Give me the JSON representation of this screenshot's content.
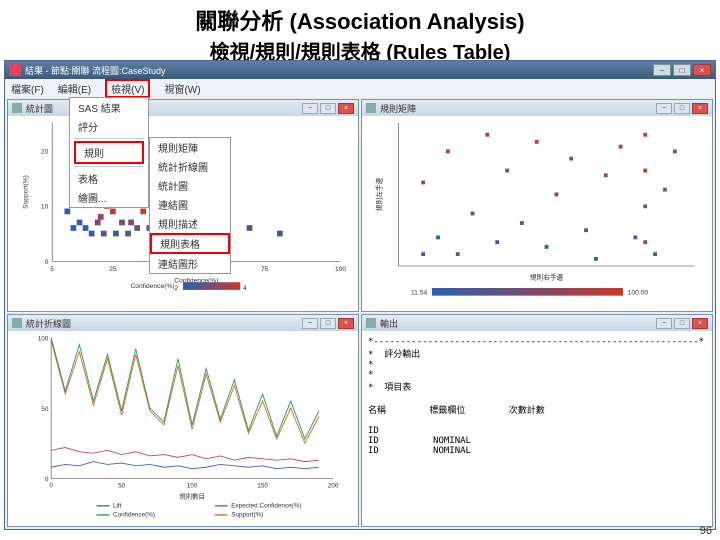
{
  "slide": {
    "title1": "關聯分析 (Association Analysis)",
    "title2": "檢視/規則/規則表格 (Rules Table)",
    "page_num": "96"
  },
  "app": {
    "titlebar": "結果 - 節點:關聯  流程圖:CaseStudy",
    "menu": {
      "file": "檔案(F)",
      "edit": "編輯(E)",
      "view": "檢視(V)",
      "window": "視窗(W)"
    }
  },
  "dropdown_main": {
    "items": [
      "SAS 結果",
      "評分"
    ],
    "boxed": "規則",
    "tail": [
      "表格",
      "繪圖..."
    ]
  },
  "dropdown_sub": {
    "items": [
      "規則矩陣",
      "統計折線圖",
      "統計圖",
      "連結圖",
      "規則描述"
    ],
    "boxed": "規則表格",
    "last": "連結圖形"
  },
  "panels": {
    "p1": {
      "title": "統計圖",
      "ylabel": "Support(%)",
      "xlabel": "Confidence(%)",
      "legend": "Confidence(%)",
      "legend_lo": "2",
      "legend_hi": "4"
    },
    "p2": {
      "title": "規則矩陣",
      "xlabel": "規則右手邊",
      "ylabel": "規則左手邊",
      "legend_lo": "11.54",
      "legend_hi": "100.00"
    },
    "p3": {
      "title": "統計折線圖",
      "xlabel": "規則數目",
      "legend1": "Lift",
      "legend2": "Expected Confidence(%)",
      "legend3": "Confidence(%)",
      "legend4": "Support(%)"
    },
    "p4": {
      "title": "輸出",
      "body_lines": [
        "*------------------------------------------------------------*",
        "*  評分輸出",
        "*",
        "*",
        "*  項目表",
        "",
        "名稱        標籤欄位        次數計數",
        "",
        "ID",
        "ID          NOMINAL",
        "ID          NOMINAL"
      ]
    }
  },
  "chart_data": [
    {
      "type": "scatter",
      "panel": "p1",
      "title": "統計圖",
      "xlabel": "Confidence(%)",
      "ylabel": "Support(%)",
      "xlim": [
        5,
        100
      ],
      "ylim": [
        0,
        25
      ],
      "color_scale": {
        "low": "#2b5fb3",
        "high": "#c63a2b",
        "variable": "index"
      },
      "series": [
        {
          "name": "rules",
          "points": [
            [
              10,
              9,
              0
            ],
            [
              12,
              6,
              0
            ],
            [
              14,
              7,
              1
            ],
            [
              16,
              6,
              0
            ],
            [
              18,
              5,
              1
            ],
            [
              20,
              7,
              5
            ],
            [
              21,
              8,
              6
            ],
            [
              22,
              5,
              2
            ],
            [
              23,
              10,
              9
            ],
            [
              25,
              9,
              8
            ],
            [
              26,
              5,
              1
            ],
            [
              28,
              7,
              4
            ],
            [
              30,
              5,
              2
            ],
            [
              31,
              7,
              5
            ],
            [
              33,
              6,
              3
            ],
            [
              35,
              9,
              9
            ],
            [
              37,
              6,
              2
            ],
            [
              38,
              5,
              1
            ],
            [
              40,
              7,
              5
            ],
            [
              42,
              5,
              0
            ],
            [
              45,
              6,
              3
            ],
            [
              48,
              9,
              8
            ],
            [
              14,
              15,
              4
            ],
            [
              18,
              20,
              9
            ],
            [
              22,
              12,
              6
            ],
            [
              50,
              5,
              1
            ],
            [
              55,
              6,
              4
            ],
            [
              60,
              5,
              0
            ],
            [
              70,
              6,
              3
            ],
            [
              80,
              5,
              1
            ]
          ]
        }
      ]
    },
    {
      "type": "scatter",
      "panel": "p2",
      "title": "規則矩陣",
      "xlabel": "規則右手邊",
      "ylabel": "規則左手邊",
      "xlim": [
        0,
        60
      ],
      "ylim": [
        0,
        60
      ],
      "color_scale": {
        "low": 11.54,
        "high": 100.0,
        "low_color": "#2b5fb3",
        "high_color": "#c63a2b"
      },
      "series": [
        {
          "name": "matrix",
          "points": [
            [
              5,
              5,
              20
            ],
            [
              5,
              35,
              60
            ],
            [
              8,
              12,
              15
            ],
            [
              10,
              48,
              90
            ],
            [
              12,
              5,
              45
            ],
            [
              15,
              22,
              30
            ],
            [
              18,
              55,
              85
            ],
            [
              20,
              10,
              25
            ],
            [
              22,
              40,
              70
            ],
            [
              25,
              18,
              35
            ],
            [
              28,
              52,
              95
            ],
            [
              30,
              8,
              20
            ],
            [
              32,
              30,
              55
            ],
            [
              35,
              45,
              80
            ],
            [
              38,
              15,
              30
            ],
            [
              40,
              3,
              18
            ],
            [
              42,
              38,
              65
            ],
            [
              45,
              50,
              90
            ],
            [
              48,
              12,
              28
            ],
            [
              50,
              25,
              48
            ],
            [
              50,
              40,
              92
            ],
            [
              50,
              10,
              75
            ],
            [
              50,
              55,
              98
            ],
            [
              52,
              5,
              22
            ],
            [
              54,
              32,
              58
            ],
            [
              56,
              48,
              88
            ]
          ]
        }
      ]
    },
    {
      "type": "line",
      "panel": "p3",
      "title": "統計折線圖",
      "xlabel": "規則數目",
      "xlim": [
        0,
        200
      ],
      "ylim": [
        0,
        100
      ],
      "series": [
        {
          "name": "Lift",
          "color": "#3a66c4",
          "values": [
            8,
            10,
            9,
            12,
            10,
            11,
            9,
            10,
            8,
            9,
            7,
            8,
            10,
            9,
            8,
            9,
            7,
            8,
            7,
            8
          ]
        },
        {
          "name": "Expected Confidence(%)",
          "color": "#c6446c",
          "values": [
            20,
            22,
            19,
            18,
            20,
            17,
            19,
            16,
            17,
            15,
            17,
            14,
            16,
            13,
            15,
            14,
            13,
            14,
            12,
            13
          ]
        },
        {
          "name": "Confidence(%)",
          "color": "#2a9d46",
          "values": [
            100,
            62,
            95,
            55,
            88,
            48,
            92,
            50,
            40,
            85,
            38,
            78,
            42,
            70,
            34,
            60,
            30,
            55,
            28,
            48
          ]
        },
        {
          "name": "Support(%)",
          "color": "#d66a3a",
          "values": [
            98,
            60,
            90,
            52,
            85,
            45,
            88,
            48,
            38,
            80,
            35,
            74,
            40,
            66,
            32,
            55,
            28,
            50,
            25,
            44
          ]
        }
      ],
      "x": [
        0,
        10,
        20,
        30,
        40,
        50,
        60,
        70,
        80,
        90,
        100,
        110,
        120,
        130,
        140,
        150,
        160,
        170,
        180,
        190
      ]
    },
    {
      "type": "table",
      "panel": "p4",
      "columns": [
        "名稱",
        "標籤欄位",
        "次數計數"
      ],
      "rows": [
        [
          "ID",
          "",
          ""
        ],
        [
          "ID",
          "NOMINAL",
          ""
        ],
        [
          "ID",
          "NOMINAL",
          ""
        ]
      ]
    }
  ]
}
